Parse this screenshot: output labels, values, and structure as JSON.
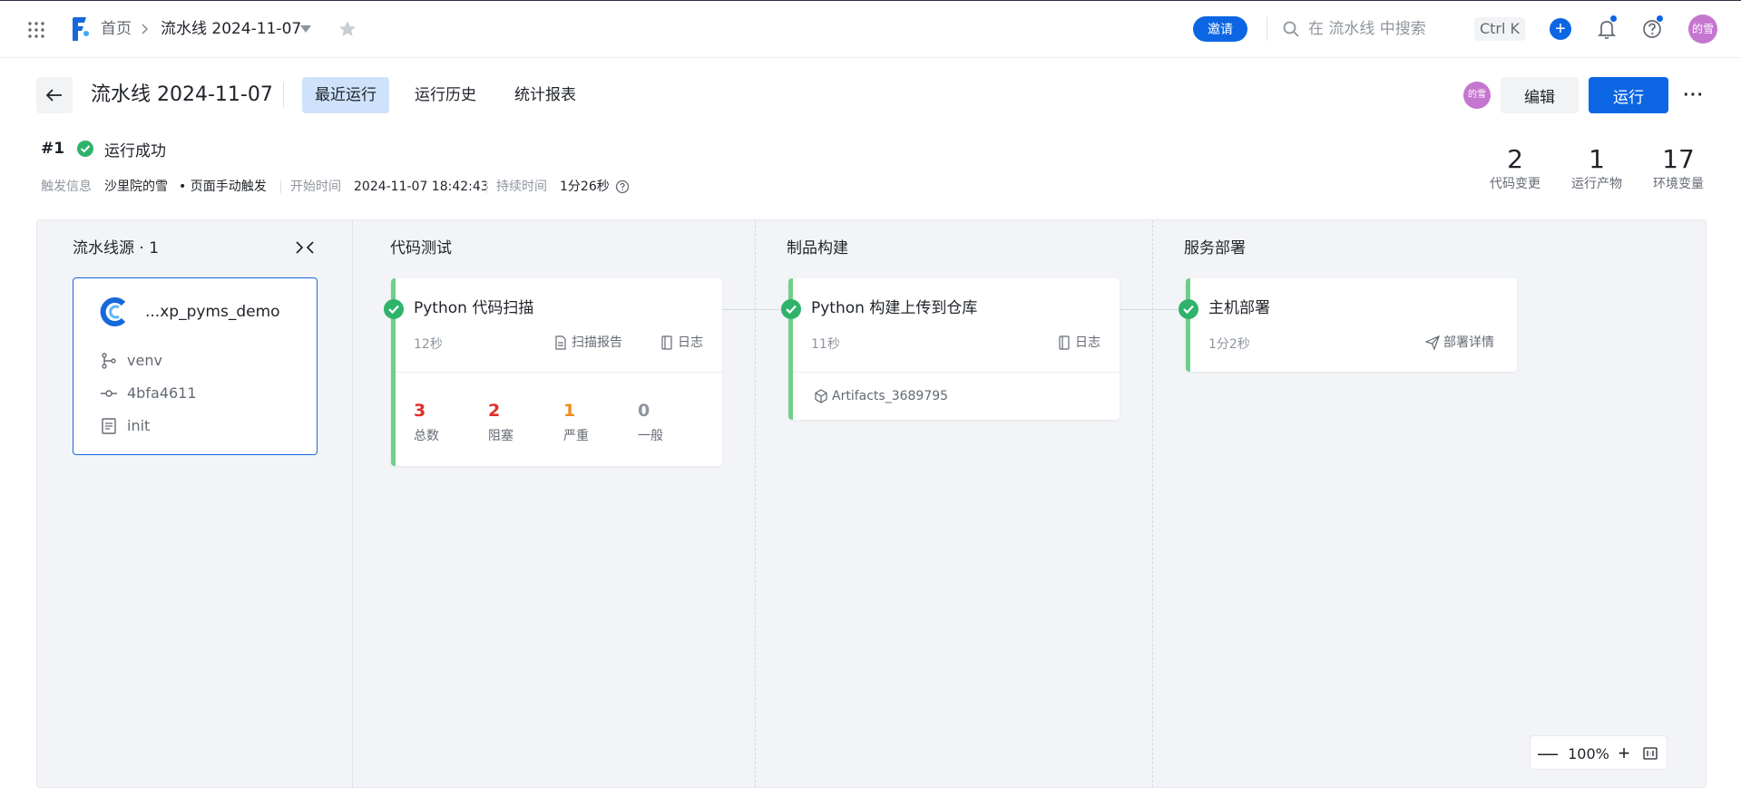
{
  "nav": {
    "home": "首页",
    "current": "流水线 2024-11-07",
    "invite": "邀请",
    "search_placeholder": "在 流水线 中搜索",
    "shortcut": "Ctrl K",
    "plus": "+",
    "avatar": "的雪"
  },
  "header": {
    "title": "流水线 2024-11-07",
    "tabs": [
      "最近运行",
      "运行历史",
      "统计报表"
    ],
    "active_tab": "最近运行",
    "avatar": "的雪",
    "edit": "编辑",
    "run": "运行",
    "more": "···"
  },
  "run": {
    "number": "#1",
    "status": "运行成功",
    "trigger_label": "触发信息",
    "trigger_user": "沙里院的雪",
    "trigger_type": "• 页面手动触发",
    "start_label": "开始时间",
    "start_time": "2024-11-07 18:42:43",
    "duration_label": "持续时间",
    "duration": "1分26秒"
  },
  "stats": [
    {
      "value": "2",
      "label": "代码变更"
    },
    {
      "value": "1",
      "label": "运行产物"
    },
    {
      "value": "17",
      "label": "环境变量"
    }
  ],
  "source": {
    "title": "流水线源 · 1",
    "repo": "...xp_pyms_demo",
    "branch": "venv",
    "commit": "4bfa4611",
    "message": "init"
  },
  "stages": [
    {
      "title": "代码测试",
      "job": {
        "name": "Python 代码扫描",
        "duration": "12秒",
        "links": [
          "扫描报告",
          "日志"
        ],
        "metrics": [
          {
            "value": "3",
            "label": "总数",
            "color": "#e02f28"
          },
          {
            "value": "2",
            "label": "阻塞",
            "color": "#e02f28"
          },
          {
            "value": "1",
            "label": "严重",
            "color": "#f08c1a"
          },
          {
            "value": "0",
            "label": "一般",
            "color": "#8f959e"
          }
        ]
      }
    },
    {
      "title": "制品构建",
      "job": {
        "name": "Python 构建上传到仓库",
        "duration": "11秒",
        "links": [
          "日志"
        ],
        "artifact": "Artifacts_3689795"
      }
    },
    {
      "title": "服务部署",
      "job": {
        "name": "主机部署",
        "duration": "1分2秒",
        "links": [
          "部署详情"
        ]
      }
    }
  ],
  "zoom": {
    "minus": "—",
    "level": "100%",
    "plus": "+"
  },
  "colors": {
    "primary": "#0c66e4",
    "success": "#2fb36a",
    "stage_bar": "#6fcf8a",
    "avatar": "#c576cf"
  }
}
